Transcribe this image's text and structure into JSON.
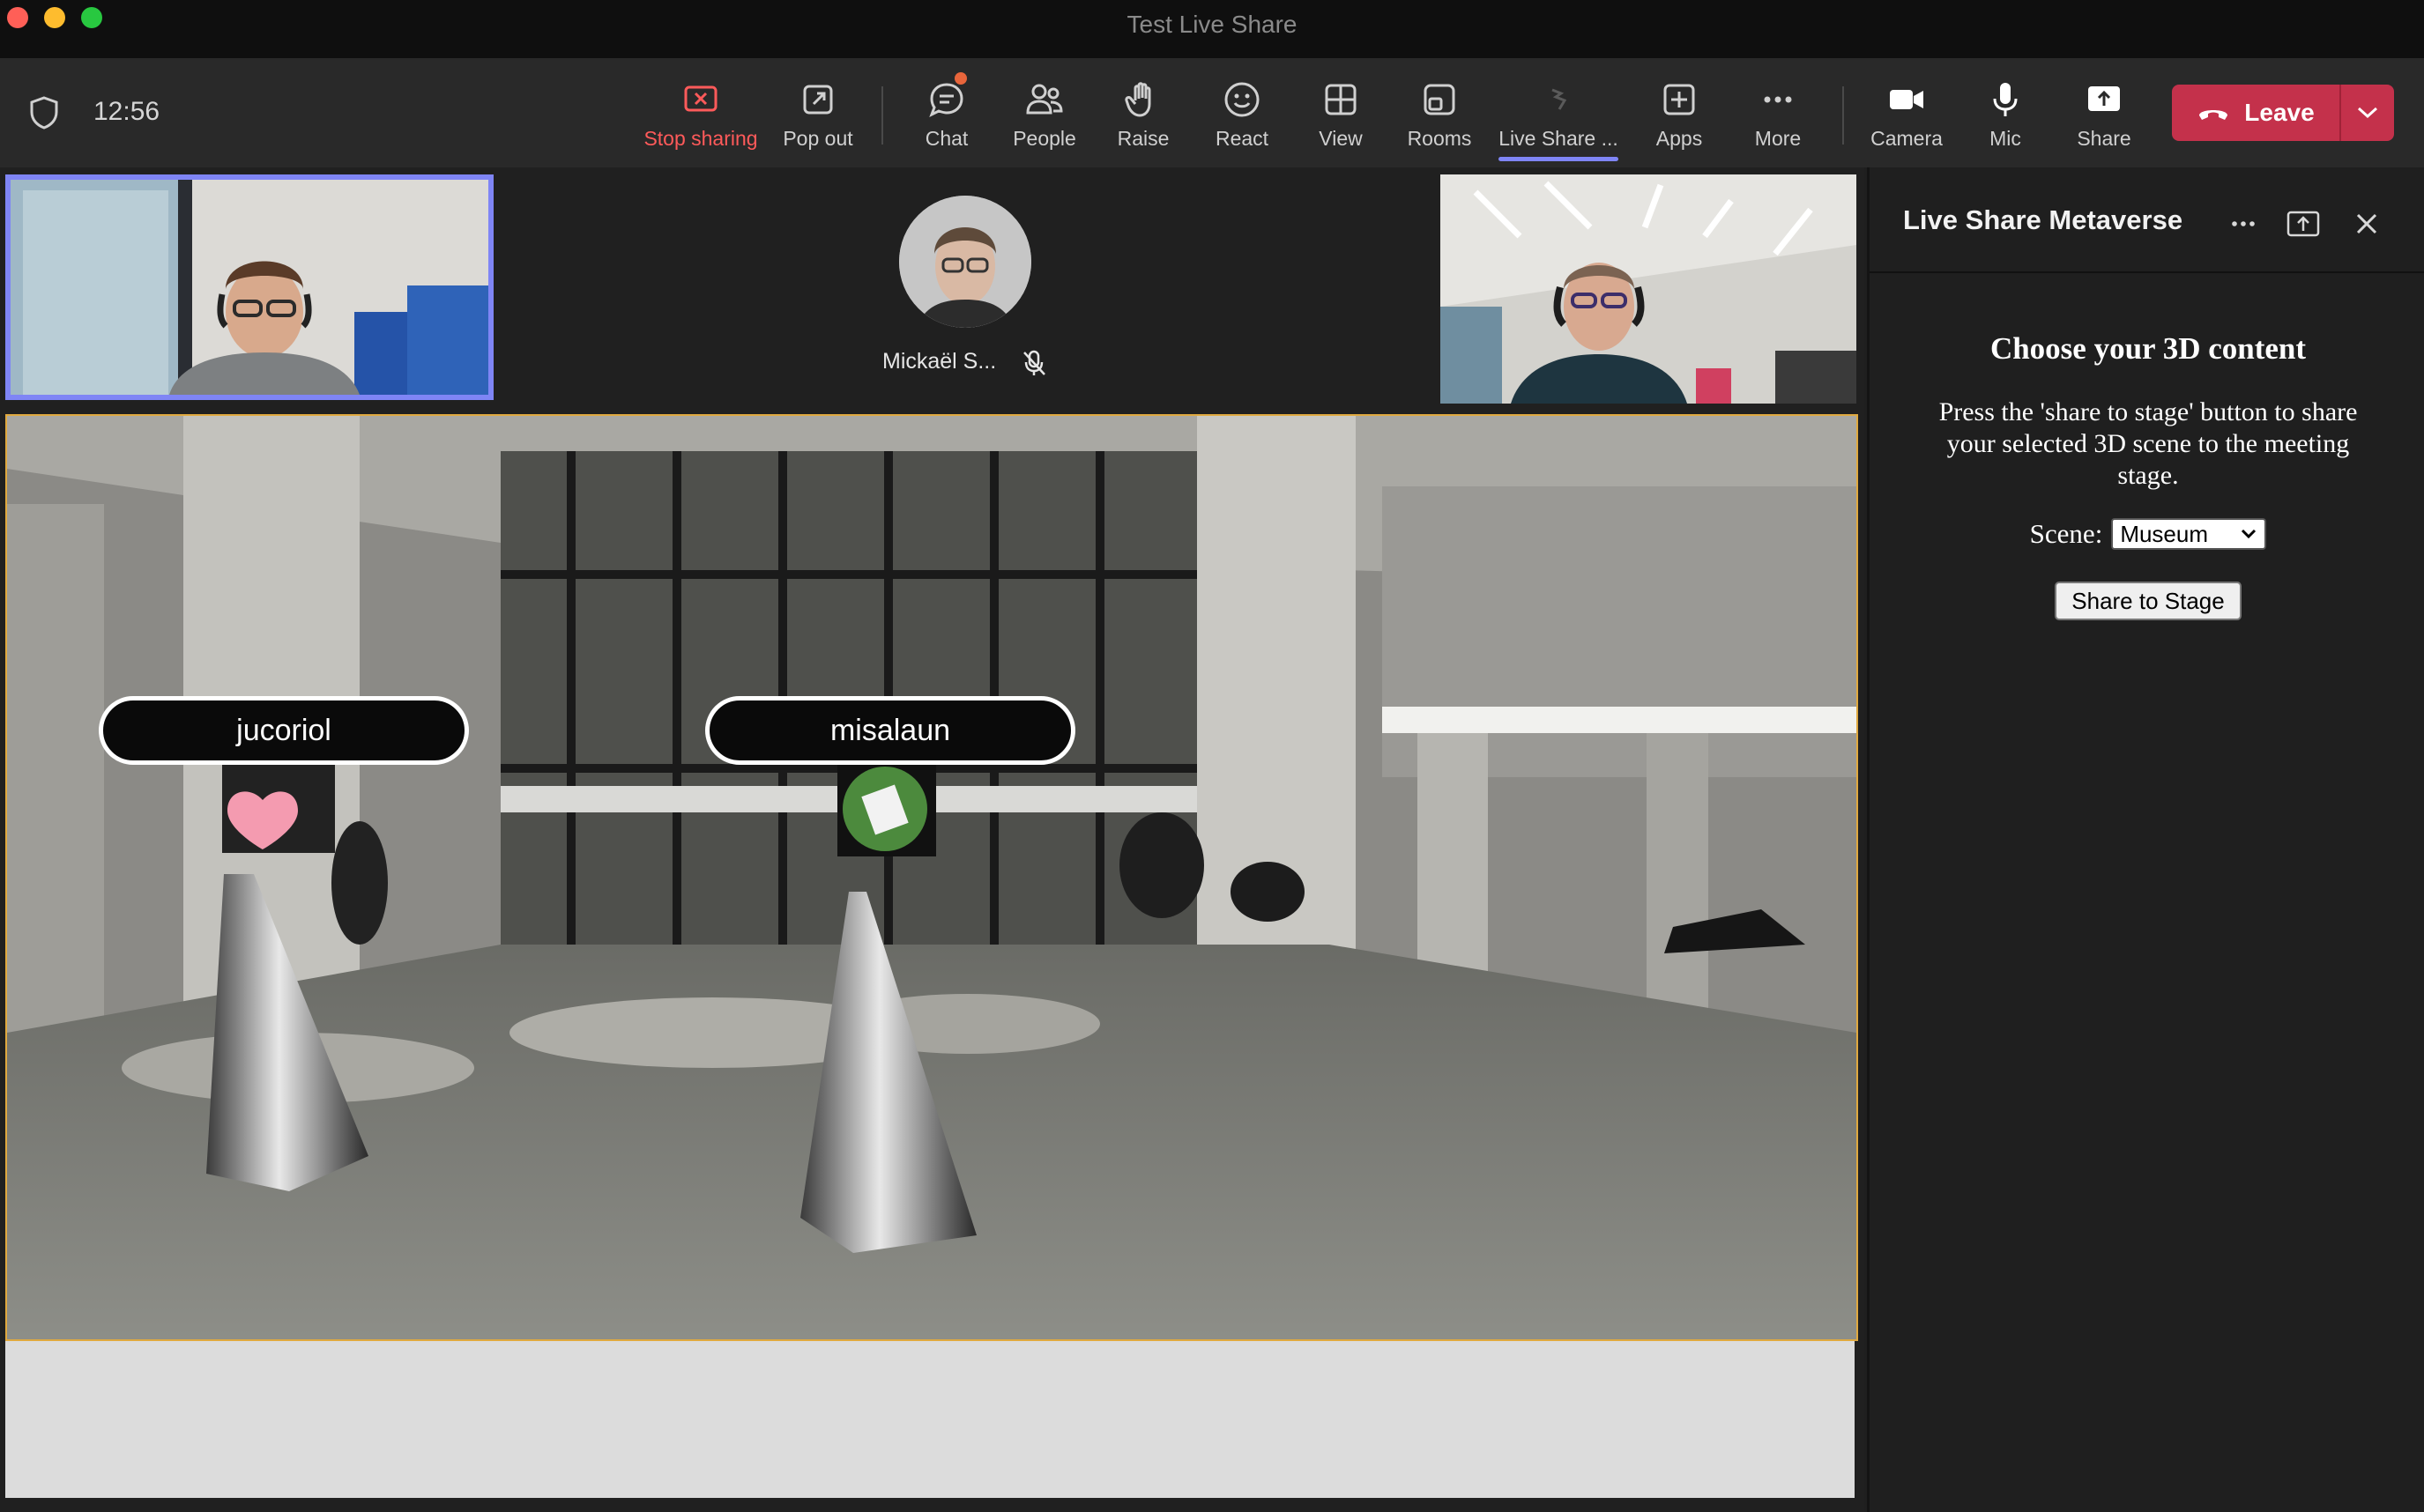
{
  "window": {
    "title": "Test Live Share"
  },
  "meeting": {
    "time": "12:56"
  },
  "toolbar": {
    "stop_sharing": "Stop sharing",
    "pop_out": "Pop out",
    "chat": "Chat",
    "people": "People",
    "raise": "Raise",
    "react": "React",
    "view": "View",
    "rooms": "Rooms",
    "live_share": "Live Share ...",
    "apps": "Apps",
    "more": "More",
    "camera": "Camera",
    "mic": "Mic",
    "share": "Share",
    "leave": "Leave"
  },
  "participants": {
    "audio_only_name": "Mickaël S..."
  },
  "stage_scene": {
    "nametags": [
      "jucoriol",
      "misalaun"
    ]
  },
  "panel": {
    "title": "Live Share Metaverse",
    "heading": "Choose your 3D content",
    "description": "Press the 'share to stage' button to share your selected 3D scene to the meeting stage.",
    "scene_label": "Scene:",
    "scene_selected": "Museum",
    "share_button": "Share to Stage"
  },
  "colors": {
    "accent": "#7f85f5",
    "leave": "#c4314b",
    "stop_sharing": "#ff5a5a",
    "share_border": "#e0a93f"
  }
}
